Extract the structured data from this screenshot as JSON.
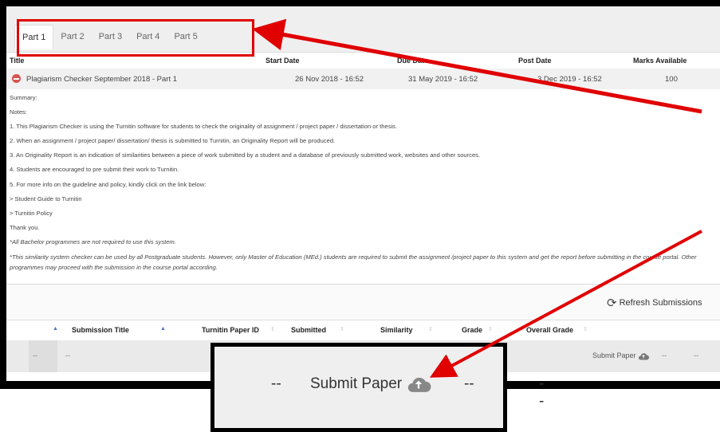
{
  "tabs": [
    "Part 1",
    "Part 2",
    "Part 3",
    "Part 4",
    "Part 5"
  ],
  "active_tab": 0,
  "table": {
    "headers": {
      "title": "Title",
      "start": "Start Date",
      "due": "Due Date",
      "post": "Post Date",
      "marks": "Marks Available"
    },
    "row": {
      "title": "Plagiarism Checker September 2018 - Part 1",
      "start": "26 Nov 2018 - 16:52",
      "due": "31 May 2019 - 16:52",
      "post": "3 Dec 2019 - 16:52",
      "marks": "100"
    }
  },
  "notes": [
    "Summary:",
    "Notes:",
    "1. This Plagiarism Checker is using the Turnitin software for students to check the originality of assignment / project paper / dissertation or thesis.",
    "2. When an assignment / project paper/ dissertation/ thesis is submitted to Turnitin, an Originality Report will be produced.",
    "3. An Originality Report is an indication of similarities between a piece of work submitted by a student and a database of previously submitted work, websites and other sources.",
    "4. Students are encouraged to pre submit their work to Turnitin.",
    "5. For more info on the guideline and policy, kindly click on the link below:",
    "> Student Guide to Turnitin",
    "> Turnitin Policy",
    "Thank you."
  ],
  "italic_notes": [
    "*All Bachelor programmes are not required to use this system.",
    "*This similarity system checker can be used by all Postgraduate students. However, only Master of Education (MEd.) students are required to submit the assignment /project paper to this system and get the report before submitting in the course portal. Other programmes may proceed with the submission in the course portal according."
  ],
  "refresh_label": "Refresh Submissions",
  "submissions": {
    "headers": {
      "title": "Submission Title",
      "paper_id": "Turnitin Paper ID",
      "submitted": "Submitted",
      "similarity": "Similarity",
      "grade": "Grade",
      "overall": "Overall Grade"
    },
    "row": {
      "c1": "--",
      "c2": "--",
      "submit": "Submit Paper",
      "c3": "--",
      "c4": "--"
    }
  },
  "callout": {
    "left": "--",
    "submit": "Submit Paper",
    "mid": "--",
    "right": "--"
  },
  "icons": {
    "status": "minus-circle-icon",
    "refresh": "refresh-icon",
    "upload": "cloud-upload-icon"
  },
  "colors": {
    "annotation": "#e00000",
    "status_red": "#d9534f",
    "sort_blue": "#4a78c2"
  }
}
